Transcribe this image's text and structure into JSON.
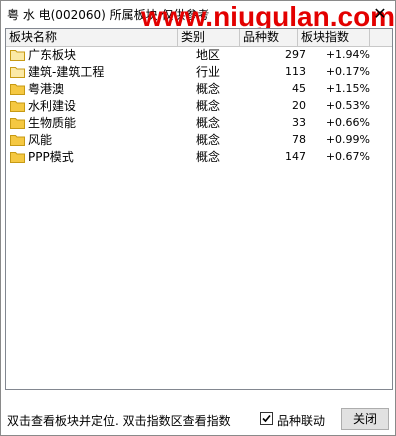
{
  "window": {
    "title": "粤 水 电(002060)   所属板块 仅供参考",
    "watermark": "www.niugulan.com",
    "close_symbol": "✕"
  },
  "table": {
    "headers": [
      "板块名称",
      "类别",
      "品种数",
      "板块指数"
    ],
    "rows": [
      {
        "name": "广东板块",
        "type": "地区",
        "count": "297",
        "index": "+1.94%",
        "icon": "folder-icon-outline"
      },
      {
        "name": "建筑-建筑工程",
        "type": "行业",
        "count": "113",
        "index": "+0.17%",
        "icon": "folder-icon-outline"
      },
      {
        "name": "粤港澳",
        "type": "概念",
        "count": "45",
        "index": "+1.15%",
        "icon": "folder-icon"
      },
      {
        "name": "水利建设",
        "type": "概念",
        "count": "20",
        "index": "+0.53%",
        "icon": "folder-icon"
      },
      {
        "name": "生物质能",
        "type": "概念",
        "count": "33",
        "index": "+0.66%",
        "icon": "folder-icon"
      },
      {
        "name": "风能",
        "type": "概念",
        "count": "78",
        "index": "+0.99%",
        "icon": "folder-icon"
      },
      {
        "name": "PPP模式",
        "type": "概念",
        "count": "147",
        "index": "+0.67%",
        "icon": "folder-icon"
      }
    ]
  },
  "footer": {
    "hint": "双击查看板块并定位. 双击指数区查看指数",
    "checkbox_label": "品种联动",
    "checkbox_checked": true,
    "check_symbol": "✔",
    "close_button": "关闭"
  },
  "colors": {
    "watermark": "#e30000",
    "folder_fill": "#f5c842",
    "folder_outline": "#c79a14"
  }
}
